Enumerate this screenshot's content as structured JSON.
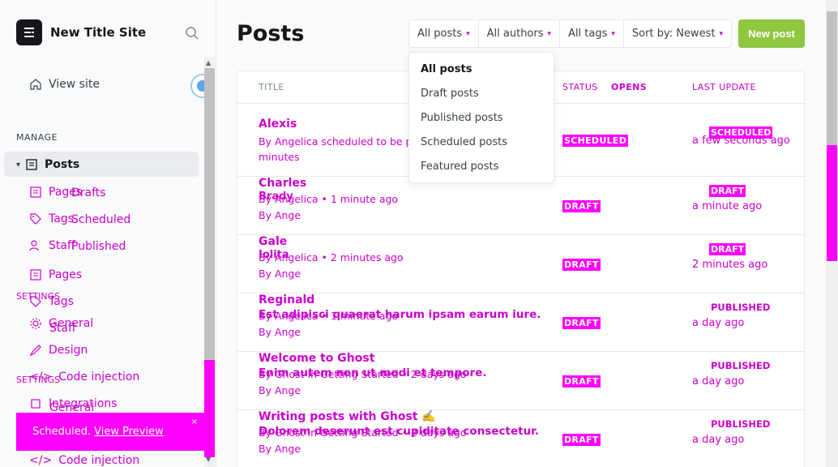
{
  "sidebar": {
    "site_name": "New Title Site",
    "view_site": "View site",
    "manage_label": "MANAGE",
    "posts": "Posts",
    "pages_under": "Pages",
    "drafts": "Drafts",
    "tags_under": "Tags",
    "scheduled": "Scheduled",
    "staff_under": "Staff",
    "published": "Published",
    "pages": "Pages",
    "settings_overlay": "SETTINGS",
    "tags": "Tags",
    "general_overlay": "General",
    "staff": "Staff",
    "design": "Design",
    "settings_label": "SETTINGS",
    "code_injection_overlay": "Code injection",
    "integrations": "Integrations",
    "general": "General",
    "code_injection": "Code injection"
  },
  "toast": {
    "text": "Scheduled.",
    "link": "View Preview",
    "close": "×"
  },
  "main": {
    "title": "Posts",
    "filters": [
      "All posts",
      "All authors",
      "All tags",
      "Sort by: Newest"
    ],
    "new_post": "New post",
    "columns": {
      "title": "TITLE",
      "status": "STATUS",
      "opens": "OPENS",
      "last": "LAST UPDATE"
    },
    "dropdown": [
      "All posts",
      "Draft posts",
      "Published posts",
      "Scheduled posts",
      "Featured posts"
    ],
    "rows": [
      {
        "title": "Alexis",
        "meta": "By Angelica scheduled to be published",
        "meta2": "minutes",
        "badge": "SCHEDULED",
        "right": "SCHEDULED",
        "time": "a few seconds ago"
      },
      {
        "title": "Charles",
        "meta_overlay": "Brady",
        "meta": "By Angelica • 1 minute ago",
        "meta2": "By Ange",
        "badge": "DRAFT",
        "right": "DRAFT",
        "time": "a minute ago"
      },
      {
        "title": "Gale",
        "meta_overlay": "Iolita",
        "meta": "By Angelica • 2 minutes ago",
        "meta2": "By Ange",
        "badge": "DRAFT",
        "right": "DRAFT",
        "time": "2 minutes ago"
      },
      {
        "title": "Reginald",
        "excerpt": "Est adipisci quaerat harum ipsam earum iure.",
        "meta": "By Angelica • 1 minute ago",
        "meta2": "By Ange",
        "badge": "DRAFT",
        "right": "PUBLISHED",
        "time": "a day ago"
      },
      {
        "title": "Welcome to Ghost",
        "excerpt": "Enim autem non ut modi et tempore.",
        "meta": "By Ghost in Getting Started • 2 days ago",
        "meta2": "By Ange",
        "badge": "DRAFT",
        "right": "PUBLISHED",
        "time": "a day ago"
      },
      {
        "title": "Writing posts with Ghost ✍️",
        "excerpt": "Dolorem deserunt est cupiditate consectetur.",
        "meta": "By Ghost in Getting Started • 2 days ago",
        "meta2": "By Ange",
        "badge": "DRAFT",
        "right": "PUBLISHED",
        "time": "a day ago"
      }
    ]
  }
}
